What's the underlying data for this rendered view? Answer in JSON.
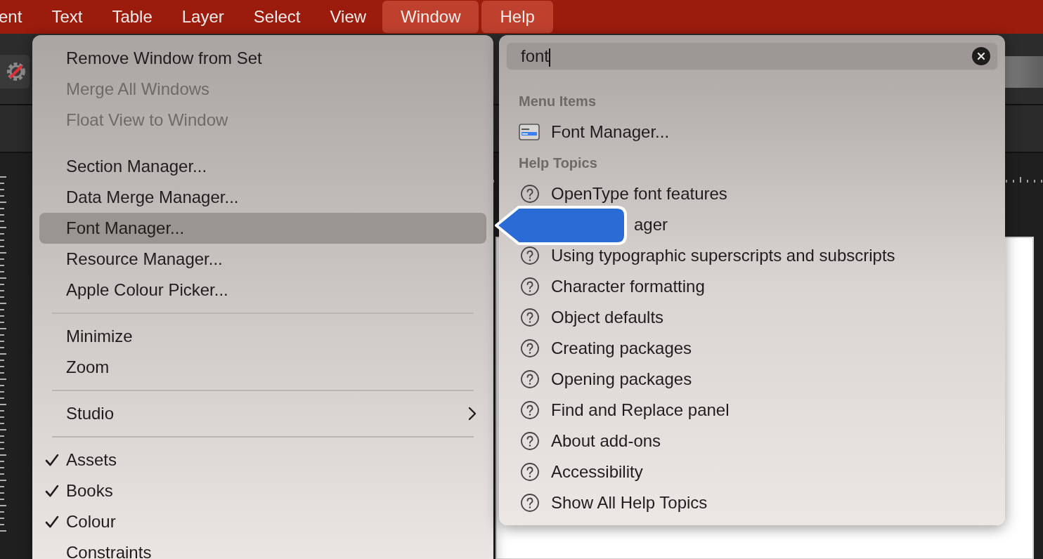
{
  "menubar": [
    {
      "label": "ent",
      "selected": false
    },
    {
      "label": "Text",
      "selected": false
    },
    {
      "label": "Table",
      "selected": false
    },
    {
      "label": "Layer",
      "selected": false
    },
    {
      "label": "Select",
      "selected": false
    },
    {
      "label": "View",
      "selected": false
    },
    {
      "label": "Window",
      "selected": true
    },
    {
      "label": "Help",
      "selected": true
    }
  ],
  "window_menu": [
    {
      "kind": "item",
      "label": "Remove Window from Set",
      "disabled": false,
      "selected": false,
      "checked": false
    },
    {
      "kind": "item",
      "label": "Merge All Windows",
      "disabled": true,
      "selected": false,
      "checked": false
    },
    {
      "kind": "item",
      "label": "Float View to Window",
      "disabled": true,
      "selected": false,
      "checked": false
    },
    {
      "kind": "separator"
    },
    {
      "kind": "item",
      "label": "Section Manager...",
      "disabled": false,
      "selected": false,
      "checked": false
    },
    {
      "kind": "item",
      "label": "Data Merge Manager...",
      "disabled": false,
      "selected": false,
      "checked": false
    },
    {
      "kind": "item",
      "label": "Font Manager...",
      "disabled": false,
      "selected": true,
      "checked": false
    },
    {
      "kind": "item",
      "label": "Resource Manager...",
      "disabled": false,
      "selected": false,
      "checked": false
    },
    {
      "kind": "item",
      "label": "Apple Colour Picker...",
      "disabled": false,
      "selected": false,
      "checked": false
    },
    {
      "kind": "separator"
    },
    {
      "kind": "item",
      "label": "Minimize",
      "disabled": false,
      "selected": false,
      "checked": false
    },
    {
      "kind": "item",
      "label": "Zoom",
      "disabled": false,
      "selected": false,
      "checked": false
    },
    {
      "kind": "separator"
    },
    {
      "kind": "item",
      "label": "Studio",
      "disabled": false,
      "selected": false,
      "checked": false,
      "submenu": true
    },
    {
      "kind": "separator"
    },
    {
      "kind": "item",
      "label": "Assets",
      "disabled": false,
      "selected": false,
      "checked": true
    },
    {
      "kind": "item",
      "label": "Books",
      "disabled": false,
      "selected": false,
      "checked": true
    },
    {
      "kind": "item",
      "label": "Colour",
      "disabled": false,
      "selected": false,
      "checked": true
    },
    {
      "kind": "item",
      "label": "Constraints",
      "disabled": false,
      "selected": false,
      "checked": false
    }
  ],
  "help_menu": {
    "search": {
      "value": "font"
    },
    "sections": [
      {
        "title": "Menu Items",
        "items": [
          {
            "kind": "menu_item",
            "label": "Font Manager..."
          }
        ]
      },
      {
        "title": "Help Topics",
        "items": [
          {
            "kind": "topic",
            "label": "OpenType font features"
          },
          {
            "kind": "covered",
            "label": "ager"
          },
          {
            "kind": "topic",
            "label": "Using typographic superscripts and subscripts"
          },
          {
            "kind": "topic",
            "label": "Character formatting"
          },
          {
            "kind": "topic",
            "label": "Object defaults"
          },
          {
            "kind": "topic",
            "label": "Creating packages"
          },
          {
            "kind": "topic",
            "label": "Opening packages"
          },
          {
            "kind": "topic",
            "label": "Find and Replace panel"
          },
          {
            "kind": "topic",
            "label": "About add-ons"
          },
          {
            "kind": "topic",
            "label": "Accessibility"
          },
          {
            "kind": "topic",
            "label": "Show All Help Topics"
          }
        ]
      }
    ]
  }
}
